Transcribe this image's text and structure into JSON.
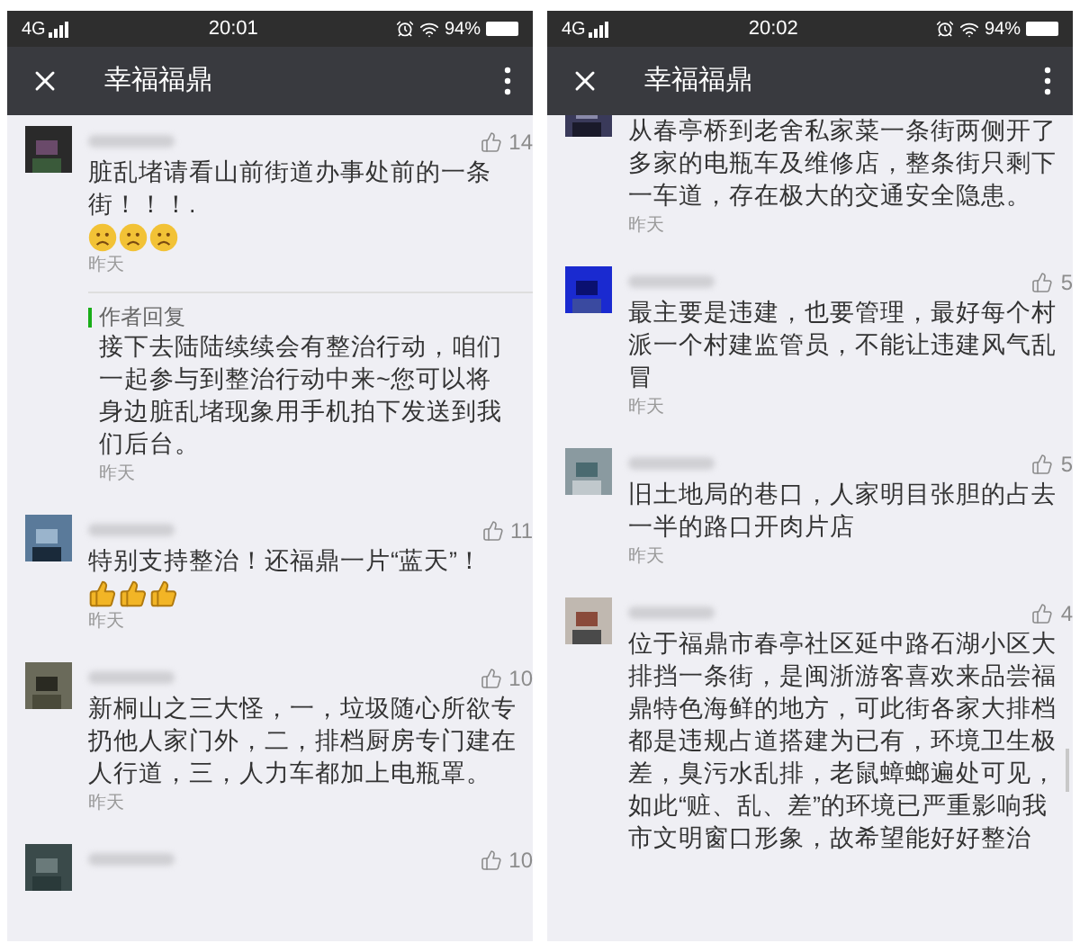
{
  "phones": [
    {
      "status_bar": {
        "network": "4G",
        "time": "20:01",
        "battery": "94%"
      },
      "title": "幸福福鼎",
      "comments": [
        {
          "kind": "full",
          "likes": "14",
          "text": "脏乱堵请看山前街道办事处前的一条街！！！.",
          "emojis": [
            {
              "kind": "frown"
            },
            {
              "kind": "frown"
            },
            {
              "kind": "frown"
            }
          ],
          "time": "昨天",
          "reply": {
            "label": "作者回复",
            "text": "接下去陆陆续续会有整治行动，咱们一起参与到整治行动中来~您可以将身边脏乱堵现象用手机拍下发送到我们后台。",
            "time": "昨天"
          }
        },
        {
          "kind": "full",
          "likes": "11",
          "text": "特别支持整治！还福鼎一片“蓝天”！",
          "emojis": [
            {
              "kind": "thumb"
            },
            {
              "kind": "thumb"
            },
            {
              "kind": "thumb"
            }
          ],
          "time": "昨天"
        },
        {
          "kind": "full",
          "likes": "10",
          "text": "新桐山之三大怪，一，垃圾随心所欲专扔他人家门外，二，排档厨房专门建在人行道，三，人力车都加上电瓶罩。",
          "time": "昨天"
        },
        {
          "kind": "cut_bottom",
          "likes": "10"
        }
      ]
    },
    {
      "status_bar": {
        "network": "4G",
        "time": "20:02",
        "battery": "94%"
      },
      "title": "幸福福鼎",
      "comments": [
        {
          "kind": "cut_top",
          "text": "从春亭桥到老舍私家菜一条街两侧开了多家的电瓶车及维修店，整条街只剩下一车道，存在极大的交通安全隐患。",
          "time": "昨天"
        },
        {
          "kind": "full",
          "likes": "5",
          "text": "最主要是违建，也要管理，最好每个村派一个村建监管员，不能让违建风气乱冒",
          "time": "昨天"
        },
        {
          "kind": "full",
          "likes": "5",
          "text": "旧土地局的巷口，人家明目张胆的占去一半的路口开肉片店",
          "time": "昨天"
        },
        {
          "kind": "full",
          "likes": "4",
          "text": "位于福鼎市春亭社区延中路石湖小区大排挡一条街，是闽浙游客喜欢来品尝福鼎特色海鲜的地方，可此街各家大排档都是违规占道搭建为已有，环境卫生极差，臭污水乱排，老鼠蟑螂遍处可见，如此“赃、乱、差”的环境已严重影响我市文明窗口形象，故希望能好好整治"
        }
      ]
    }
  ]
}
